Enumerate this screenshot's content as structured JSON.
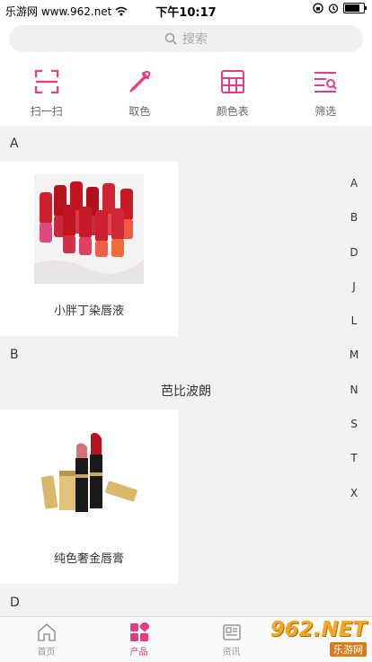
{
  "status_bar": {
    "carrier": "乐游网 www.962.net",
    "time": "下午10:17"
  },
  "search": {
    "placeholder": "搜索"
  },
  "tools": [
    {
      "label": "扫一扫",
      "icon": "scan-icon"
    },
    {
      "label": "取色",
      "icon": "eyedropper-icon"
    },
    {
      "label": "颜色表",
      "icon": "color-table-icon"
    },
    {
      "label": "筛选",
      "icon": "filter-list-icon"
    }
  ],
  "sections": [
    {
      "letter": "A"
    },
    {
      "letter": "B"
    },
    {
      "letter": "D"
    }
  ],
  "brand_b": "芭比波朗",
  "products": [
    {
      "name": "小胖丁染唇液"
    },
    {
      "name": "纯色奢金唇膏"
    }
  ],
  "index_letters": [
    "A",
    "B",
    "D",
    "J",
    "L",
    "M",
    "N",
    "S",
    "T",
    "X"
  ],
  "tabs": [
    {
      "label": "首页",
      "icon": "home-icon",
      "active": false
    },
    {
      "label": "产品",
      "icon": "products-icon",
      "active": true
    },
    {
      "label": "资讯",
      "icon": "news-icon",
      "active": false
    }
  ],
  "watermark": {
    "big": "962.NET",
    "small": "乐游网"
  },
  "colors": {
    "accent": "#e83b86",
    "background": "#f2f2f2"
  }
}
